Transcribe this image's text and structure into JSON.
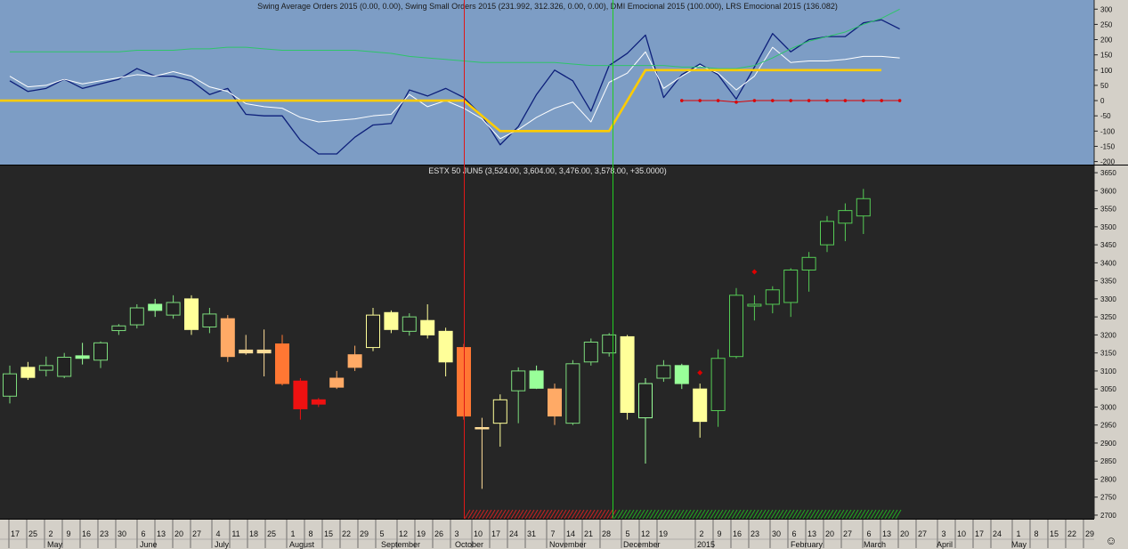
{
  "indicator_pane": {
    "title": "Swing Average Orders 2015 (0.00, 0.00), Swing Small Orders 2015 (231.992, 312.326, 0.00, 0.00), DMI Emocional 2015 (100.000), LRS Emocional 2015 (136.082)",
    "y_ticks": [
      "300",
      "250",
      "200",
      "150",
      "100",
      "50",
      "0",
      "-50",
      "-100",
      "-150",
      "-200"
    ]
  },
  "price_pane": {
    "title": "ESTX 50 JUN5 (3,524.00, 3,604.00, 3,476.00, 3,578.00, +35.0000)",
    "y_ticks": [
      "3650",
      "3600",
      "3550",
      "3500",
      "3450",
      "3400",
      "3350",
      "3300",
      "3250",
      "3200",
      "3150",
      "3100",
      "3050",
      "3000",
      "2950",
      "2900",
      "2850",
      "2800",
      "2750",
      "2700"
    ]
  },
  "time_axis": {
    "day_labels": [
      "17",
      "25",
      "2",
      "9",
      "16",
      "23",
      "30",
      "6",
      "13",
      "20",
      "27",
      "4",
      "11",
      "18",
      "25",
      "1",
      "8",
      "15",
      "22",
      "29",
      "5",
      "12",
      "19",
      "26",
      "3",
      "10",
      "17",
      "24",
      "31",
      "7",
      "14",
      "21",
      "28",
      "5",
      "12",
      "19",
      "2",
      "9",
      "16",
      "23",
      "30",
      "6",
      "13",
      "20",
      "27",
      "6",
      "13",
      "20",
      "27",
      "3",
      "10",
      "17",
      "24",
      "1",
      "8",
      "15",
      "22",
      "29"
    ],
    "month_labels": [
      "May",
      "June",
      "July",
      "August",
      "September",
      "October",
      "November",
      "December",
      "2015",
      "February",
      "March",
      "April",
      "May"
    ]
  },
  "colors": {
    "indicator_bg": "#7d9dc5",
    "price_bg": "#262626",
    "axis_bg": "#d4d0c8",
    "blue_line": "#0d1f7a",
    "white_line": "#ffffff",
    "green_line": "#2ec46a",
    "yellow_line": "#ffcc00",
    "red_vline": "#e01818",
    "green_vline": "#22cc22",
    "signal_dots": "#dd0000"
  },
  "smiley": "☺",
  "chart_data": [
    {
      "type": "line",
      "title": "Swing Average Orders 2015 (0.00, 0.00), Swing Small Orders 2015 (231.992, 312.326, 0.00, 0.00), DMI Emocional 2015 (100.000), LRS Emocional 2015 (136.082)",
      "ylim": [
        -210,
        330
      ],
      "series": [
        {
          "name": "blue",
          "values": [
            65,
            30,
            40,
            70,
            40,
            55,
            70,
            105,
            80,
            80,
            65,
            20,
            40,
            -45,
            -50,
            -50,
            -130,
            -175,
            -175,
            -120,
            -80,
            -75,
            35,
            15,
            40,
            10,
            -50,
            -145,
            -85,
            20,
            100,
            65,
            -35,
            115,
            155,
            215,
            10,
            85,
            120,
            85,
            5,
            110,
            220,
            160,
            200,
            210,
            210,
            255,
            265,
            235
          ]
        },
        {
          "name": "white",
          "values": [
            80,
            45,
            50,
            70,
            55,
            65,
            75,
            85,
            80,
            95,
            80,
            45,
            30,
            -10,
            -20,
            -25,
            -55,
            -70,
            -65,
            -60,
            -50,
            -45,
            20,
            -20,
            0,
            -25,
            -60,
            -125,
            -95,
            -55,
            -25,
            -5,
            -70,
            60,
            90,
            160,
            40,
            80,
            115,
            90,
            35,
            80,
            175,
            125,
            130,
            130,
            135,
            145,
            145,
            140
          ]
        },
        {
          "name": "green",
          "values": [
            160,
            160,
            160,
            160,
            160,
            160,
            160,
            165,
            165,
            165,
            170,
            170,
            175,
            175,
            170,
            165,
            165,
            165,
            165,
            165,
            160,
            155,
            145,
            140,
            135,
            130,
            125,
            125,
            125,
            125,
            125,
            120,
            115,
            115,
            115,
            115,
            115,
            110,
            110,
            105,
            105,
            115,
            140,
            170,
            195,
            210,
            225,
            250,
            270,
            300
          ]
        },
        {
          "name": "yellow",
          "x": [
            0,
            25,
            27,
            33,
            35,
            49
          ],
          "values": [
            0,
            0,
            -100,
            -100,
            100,
            100
          ]
        },
        {
          "name": "signal",
          "x": [
            37,
            38,
            39,
            40,
            41,
            42,
            43,
            44,
            45,
            46,
            47,
            48,
            49
          ],
          "values": [
            0,
            0,
            0,
            -5,
            0,
            0,
            0,
            0,
            0,
            0,
            0,
            0,
            0
          ]
        }
      ]
    },
    {
      "type": "candlestick",
      "title": "ESTX 50 JUN5 (3,524.00, 3,604.00, 3,476.00, 3,578.00, +35.0000)",
      "ylim": [
        2690,
        3670
      ],
      "candles": [
        {
          "o": 3030,
          "h": 3115,
          "l": 3010,
          "c": 3092,
          "color": "#222",
          "border": "#7cdc7c"
        },
        {
          "o": 3082,
          "h": 3125,
          "l": 3075,
          "c": 3110,
          "color": "#ffff99",
          "border": "#ffff99"
        },
        {
          "o": 3102,
          "h": 3140,
          "l": 3085,
          "c": 3115,
          "color": "#222",
          "border": "#7cdc7c"
        },
        {
          "o": 3085,
          "h": 3150,
          "l": 3080,
          "c": 3138,
          "color": "#222",
          "border": "#7cdc7c"
        },
        {
          "o": 3135,
          "h": 3178,
          "l": 3118,
          "c": 3142,
          "color": "#99ff99",
          "border": "#99ff99"
        },
        {
          "o": 3130,
          "h": 3182,
          "l": 3108,
          "c": 3178,
          "color": "#222",
          "border": "#7cdc7c"
        },
        {
          "o": 3212,
          "h": 3230,
          "l": 3200,
          "c": 3225,
          "color": "#222",
          "border": "#7cdc7c"
        },
        {
          "o": 3228,
          "h": 3285,
          "l": 3218,
          "c": 3275,
          "color": "#222",
          "border": "#7cdc7c"
        },
        {
          "o": 3268,
          "h": 3300,
          "l": 3250,
          "c": 3285,
          "color": "#99ff99",
          "border": "#99ff99"
        },
        {
          "o": 3255,
          "h": 3310,
          "l": 3245,
          "c": 3290,
          "color": "#222",
          "border": "#7cdc7c"
        },
        {
          "o": 3300,
          "h": 3310,
          "l": 3200,
          "c": 3215,
          "color": "#ffff99",
          "border": "#ffff99"
        },
        {
          "o": 3222,
          "h": 3275,
          "l": 3205,
          "c": 3258,
          "color": "#222",
          "border": "#7cdc7c"
        },
        {
          "o": 3245,
          "h": 3255,
          "l": 3125,
          "c": 3140,
          "color": "#ffaa66",
          "border": "#ffaa66"
        },
        {
          "o": 3158,
          "h": 3200,
          "l": 3145,
          "c": 3150,
          "color": "#ffdd99",
          "border": "#ffdd99"
        },
        {
          "o": 3158,
          "h": 3215,
          "l": 3085,
          "c": 3150,
          "color": "#ffdd99",
          "border": "#ffdd99"
        },
        {
          "o": 3175,
          "h": 3200,
          "l": 3060,
          "c": 3065,
          "color": "#ff7733",
          "border": "#ff7733"
        },
        {
          "o": 3072,
          "h": 3080,
          "l": 2965,
          "c": 2995,
          "color": "#ee1111",
          "border": "#ee1111"
        },
        {
          "o": 3020,
          "h": 3025,
          "l": 3000,
          "c": 3008,
          "color": "#ee1111",
          "border": "#ee1111"
        },
        {
          "o": 3055,
          "h": 3100,
          "l": 3050,
          "c": 3080,
          "color": "#ffaa66",
          "border": "#ffaa66"
        },
        {
          "o": 3110,
          "h": 3170,
          "l": 3100,
          "c": 3145,
          "color": "#ffaa66",
          "border": "#ffaa66"
        },
        {
          "o": 3165,
          "h": 3275,
          "l": 3155,
          "c": 3255,
          "color": "#222",
          "border": "#ffff99"
        },
        {
          "o": 3262,
          "h": 3268,
          "l": 3205,
          "c": 3215,
          "color": "#ffff99",
          "border": "#ffff99"
        },
        {
          "o": 3210,
          "h": 3260,
          "l": 3198,
          "c": 3250,
          "color": "#222",
          "border": "#7cdc7c"
        },
        {
          "o": 3240,
          "h": 3285,
          "l": 3190,
          "c": 3200,
          "color": "#ffff99",
          "border": "#ffff99"
        },
        {
          "o": 3210,
          "h": 3220,
          "l": 3085,
          "c": 3125,
          "color": "#ffff99",
          "border": "#ffff99"
        },
        {
          "o": 3165,
          "h": 3175,
          "l": 2965,
          "c": 2975,
          "color": "#ff7733",
          "border": "#ff7733"
        },
        {
          "o": 2943,
          "h": 2970,
          "l": 2773,
          "c": 2943,
          "color": "#ffdd99",
          "border": "#ffdd99"
        },
        {
          "o": 2955,
          "h": 3035,
          "l": 2890,
          "c": 3020,
          "color": "#222",
          "border": "#ffff99"
        },
        {
          "o": 3045,
          "h": 3110,
          "l": 2955,
          "c": 3100,
          "color": "#222",
          "border": "#7cdc7c"
        },
        {
          "o": 3100,
          "h": 3115,
          "l": 3050,
          "c": 3052,
          "color": "#99ff99",
          "border": "#99ff99"
        },
        {
          "o": 3050,
          "h": 3065,
          "l": 2950,
          "c": 2975,
          "color": "#ffaa66",
          "border": "#ffaa66"
        },
        {
          "o": 2955,
          "h": 3130,
          "l": 2950,
          "c": 3120,
          "color": "#222",
          "border": "#7cdc7c"
        },
        {
          "o": 3125,
          "h": 3190,
          "l": 3115,
          "c": 3180,
          "color": "#222",
          "border": "#7cdc7c"
        },
        {
          "o": 3150,
          "h": 3205,
          "l": 3140,
          "c": 3200,
          "color": "#222",
          "border": "#7cdc7c"
        },
        {
          "o": 3195,
          "h": 3200,
          "l": 2965,
          "c": 2985,
          "color": "#ffff99",
          "border": "#ffff99"
        },
        {
          "o": 2970,
          "h": 3080,
          "l": 2843,
          "c": 3065,
          "color": "#222",
          "border": "#99ff99"
        },
        {
          "o": 3080,
          "h": 3130,
          "l": 3070,
          "c": 3115,
          "color": "#222",
          "border": "#7cdc7c"
        },
        {
          "o": 3115,
          "h": 3120,
          "l": 3050,
          "c": 3065,
          "color": "#99ff99",
          "border": "#99ff99"
        },
        {
          "o": 3050,
          "h": 3065,
          "l": 2915,
          "c": 2960,
          "color": "#ffff99",
          "border": "#ffff99"
        },
        {
          "o": 2990,
          "h": 3160,
          "l": 2945,
          "c": 3135,
          "color": "#222",
          "border": "#55cc55"
        },
        {
          "o": 3140,
          "h": 3330,
          "l": 3135,
          "c": 3310,
          "color": "#222",
          "border": "#55cc55"
        },
        {
          "o": 3280,
          "h": 3310,
          "l": 3240,
          "c": 3285,
          "color": "#222",
          "border": "#55cc55"
        },
        {
          "o": 3285,
          "h": 3335,
          "l": 3260,
          "c": 3325,
          "color": "#222",
          "border": "#55cc55"
        },
        {
          "o": 3290,
          "h": 3385,
          "l": 3250,
          "c": 3380,
          "color": "#222",
          "border": "#55cc55"
        },
        {
          "o": 3380,
          "h": 3430,
          "l": 3320,
          "c": 3415,
          "color": "#222",
          "border": "#55cc55"
        },
        {
          "o": 3450,
          "h": 3530,
          "l": 3430,
          "c": 3515,
          "color": "#222",
          "border": "#55cc55"
        },
        {
          "o": 3510,
          "h": 3565,
          "l": 3460,
          "c": 3545,
          "color": "#222",
          "border": "#55cc55"
        },
        {
          "o": 3530,
          "h": 3605,
          "l": 3480,
          "c": 3578,
          "color": "#222",
          "border": "#55cc55"
        }
      ],
      "markers": [
        {
          "i": 38,
          "y": 3095
        },
        {
          "i": 41,
          "y": 3375
        }
      ]
    }
  ]
}
